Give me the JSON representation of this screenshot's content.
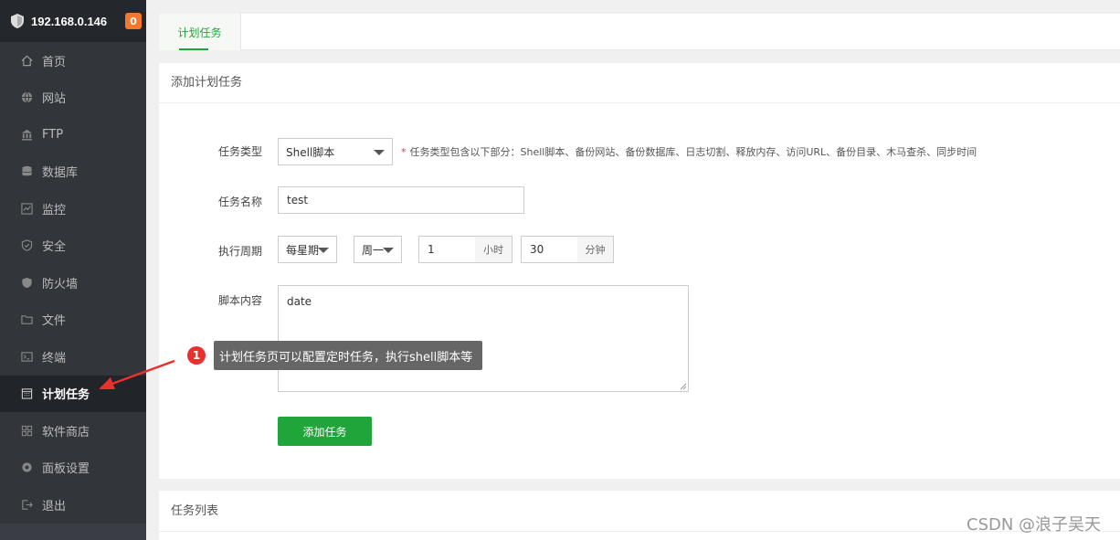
{
  "sidebar": {
    "server_ip": "192.168.0.146",
    "badge_count": "0",
    "items": [
      {
        "label": "首页",
        "icon": "home-icon"
      },
      {
        "label": "网站",
        "icon": "globe-icon"
      },
      {
        "label": "FTP",
        "icon": "ftp-icon"
      },
      {
        "label": "数据库",
        "icon": "database-icon"
      },
      {
        "label": "监控",
        "icon": "monitor-icon"
      },
      {
        "label": "安全",
        "icon": "shield-check-icon"
      },
      {
        "label": "防火墙",
        "icon": "firewall-shield-icon"
      },
      {
        "label": "文件",
        "icon": "folder-icon"
      },
      {
        "label": "终端",
        "icon": "terminal-icon"
      },
      {
        "label": "计划任务",
        "icon": "calendar-icon",
        "active": true
      },
      {
        "label": "软件商店",
        "icon": "grid-icon"
      },
      {
        "label": "面板设置",
        "icon": "gear-icon"
      },
      {
        "label": "退出",
        "icon": "logout-icon"
      }
    ]
  },
  "tabs": [
    {
      "label": "计划任务",
      "active": true
    }
  ],
  "add_panel": {
    "title": "添加计划任务",
    "task_type": {
      "label": "任务类型",
      "value": "Shell脚本",
      "hint": "任务类型包含以下部分：Shell脚本、备份网站、备份数据库、日志切割、释放内存、访问URL、备份目录、木马查杀、同步时间"
    },
    "task_name": {
      "label": "任务名称",
      "value": "test"
    },
    "cycle": {
      "label": "执行周期",
      "period": "每星期",
      "weekday": "周一",
      "hour": "1",
      "hour_unit": "小时",
      "minute": "30",
      "minute_unit": "分钟"
    },
    "script": {
      "label": "脚本内容",
      "value": "date"
    },
    "submit_label": "添加任务"
  },
  "list_panel": {
    "title": "任务列表"
  },
  "annotation": {
    "number": "1",
    "text": "计划任务页可以配置定时任务，执行shell脚本等"
  },
  "watermark": "CSDN @浪子吴天",
  "colors": {
    "accent": "#20a53a",
    "sidebar_bg": "#32363b",
    "badge": "#f5772b",
    "marker": "#e8302f"
  }
}
